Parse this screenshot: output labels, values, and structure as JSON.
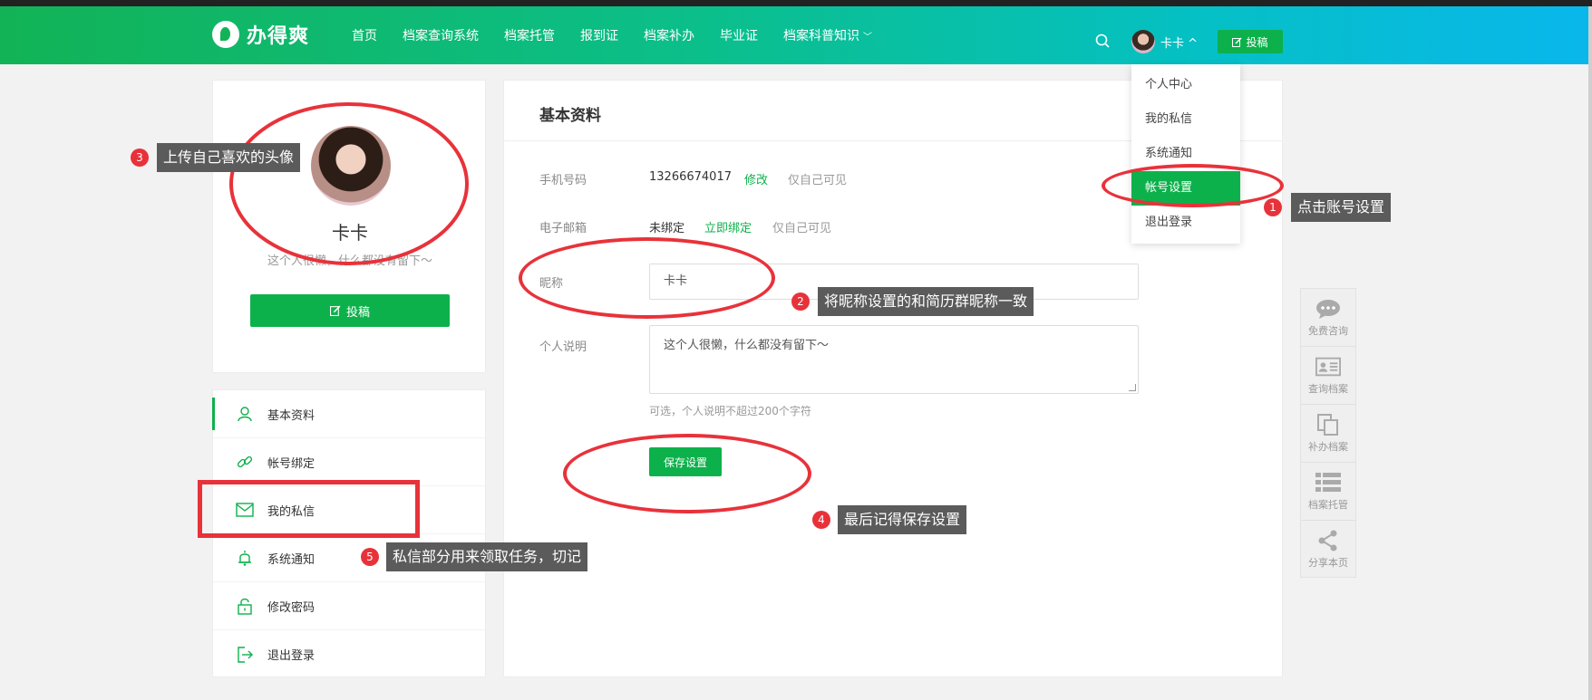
{
  "header": {
    "logo_text": "办得爽",
    "nav": [
      {
        "label": "首页"
      },
      {
        "label": "档案查询系统"
      },
      {
        "label": "档案托管"
      },
      {
        "label": "报到证"
      },
      {
        "label": "档案补办"
      },
      {
        "label": "毕业证"
      },
      {
        "label": "档案科普知识",
        "has_dropdown": true
      }
    ],
    "user_name": "卡卡",
    "user_chevron": "^",
    "post_button": "投稿"
  },
  "dropdown": {
    "items": [
      "个人中心",
      "我的私信",
      "系统通知",
      "帐号设置",
      "退出登录"
    ],
    "active_index": 3
  },
  "profile": {
    "name": "卡卡",
    "bio": "这个人很懒，什么都没有留下～",
    "post_button": "投稿"
  },
  "side_menu": {
    "items": [
      {
        "label": "基本资料",
        "icon": "user-icon"
      },
      {
        "label": "帐号绑定",
        "icon": "link-icon"
      },
      {
        "label": "我的私信",
        "icon": "mail-icon"
      },
      {
        "label": "系统通知",
        "icon": "bell-icon"
      },
      {
        "label": "修改密码",
        "icon": "lock-icon"
      },
      {
        "label": "退出登录",
        "icon": "logout-icon"
      }
    ],
    "active_index": 0
  },
  "main": {
    "title": "基本资料",
    "phone": {
      "label": "手机号码",
      "value": "13266674017",
      "action": "修改",
      "visibility": "仅自己可见"
    },
    "email": {
      "label": "电子邮箱",
      "value": "未绑定",
      "action": "立即绑定",
      "visibility": "仅自己可见"
    },
    "nickname": {
      "label": "昵称",
      "value": "卡卡"
    },
    "intro": {
      "label": "个人说明",
      "value": "这个人很懒，什么都没有留下～",
      "hint": "可选，个人说明不超过200个字符"
    },
    "save_button": "保存设置"
  },
  "float_bar": [
    {
      "label": "免费咨询",
      "icon": "chat-icon"
    },
    {
      "label": "查询档案",
      "icon": "id-card-icon"
    },
    {
      "label": "补办档案",
      "icon": "copy-icon"
    },
    {
      "label": "档案托管",
      "icon": "list-icon"
    },
    {
      "label": "分享本页",
      "icon": "share-icon"
    }
  ],
  "annotations": [
    {
      "number": "1",
      "text": "点击账号设置"
    },
    {
      "number": "2",
      "text": "将昵称设置的和简历群昵称一致"
    },
    {
      "number": "3",
      "text": "上传自己喜欢的头像"
    },
    {
      "number": "4",
      "text": "最后记得保存设置"
    },
    {
      "number": "5",
      "text": "私信部分用来领取任务，切记"
    }
  ],
  "colors": {
    "brand_green": "#0db14b",
    "annotation_red": "#e8323a",
    "tip_bg": "#5b5b5b"
  }
}
